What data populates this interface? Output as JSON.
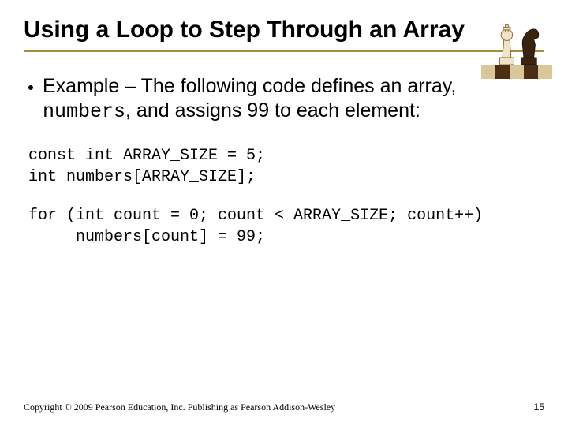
{
  "slide": {
    "title": "Using a Loop to Step Through an Array",
    "bullet": {
      "prefix": "Example – The following code defines an array, ",
      "mono": "numbers",
      "suffix": ", and assigns 99 to each element:"
    },
    "code1": "const int ARRAY_SIZE = 5;\nint numbers[ARRAY_SIZE];",
    "code2": "for (int count = 0; count < ARRAY_SIZE; count++)\n     numbers[count] = 99;",
    "copyright": "Copyright © 2009 Pearson Education, Inc. Publishing as Pearson Addison-Wesley",
    "page_number": "15"
  }
}
